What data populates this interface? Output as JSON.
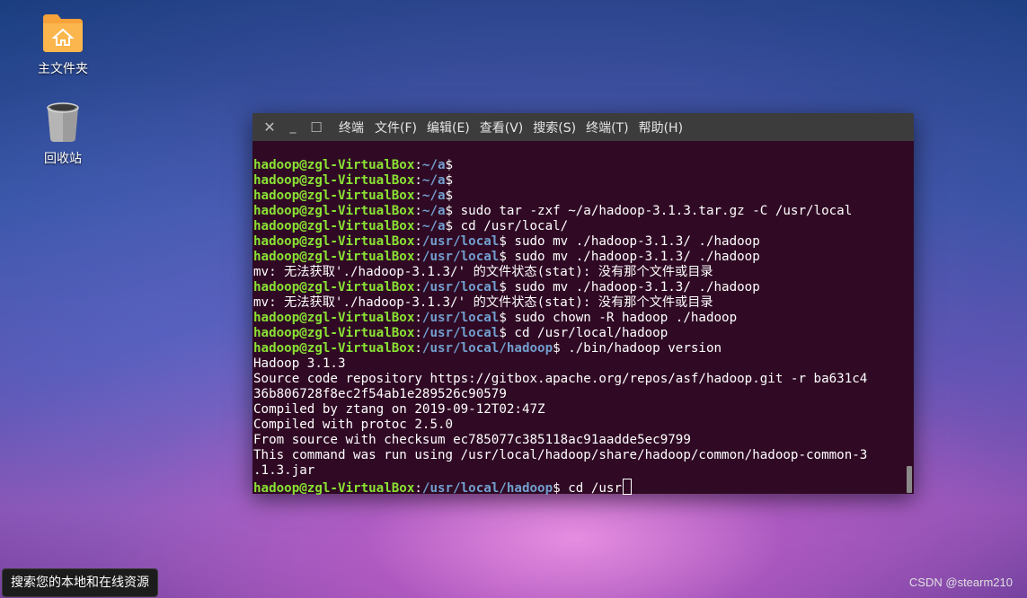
{
  "desktop": {
    "icons": [
      {
        "label": "主文件夹",
        "icon": "home-folder-icon"
      },
      {
        "label": "回收站",
        "icon": "trash-icon"
      }
    ],
    "search_tooltip": "搜索您的本地和在线资源",
    "watermark": "CSDN @stearm210"
  },
  "terminal": {
    "title": "终端",
    "window_buttons": [
      "✕",
      "_",
      "☐"
    ],
    "menu": [
      "文件(F)",
      "编辑(E)",
      "查看(V)",
      "搜索(S)",
      "终端(T)",
      "帮助(H)"
    ],
    "lines": [
      {
        "user": "hadoop@zgl-VirtualBox",
        "path": "~/a",
        "text": "$"
      },
      {
        "user": "hadoop@zgl-VirtualBox",
        "path": "~/a",
        "text": "$"
      },
      {
        "user": "hadoop@zgl-VirtualBox",
        "path": "~/a",
        "text": "$"
      },
      {
        "user": "hadoop@zgl-VirtualBox",
        "path": "~/a",
        "text": "$ sudo tar -zxf ~/a/hadoop-3.1.3.tar.gz -C /usr/local"
      },
      {
        "user": "hadoop@zgl-VirtualBox",
        "path": "~/a",
        "text": "$ cd /usr/local/"
      },
      {
        "user": "hadoop@zgl-VirtualBox",
        "path": "/usr/local",
        "text": "$ sudo mv ./hadoop-3.1.3/ ./hadoop"
      },
      {
        "user": "hadoop@zgl-VirtualBox",
        "path": "/usr/local",
        "text": "$ sudo mv ./hadoop-3.1.3/ ./hadoop"
      },
      {
        "text": "mv: 无法获取'./hadoop-3.1.3/' 的文件状态(stat): 没有那个文件或目录"
      },
      {
        "user": "hadoop@zgl-VirtualBox",
        "path": "/usr/local",
        "text": "$ sudo mv ./hadoop-3.1.3/ ./hadoop"
      },
      {
        "text": "mv: 无法获取'./hadoop-3.1.3/' 的文件状态(stat): 没有那个文件或目录"
      },
      {
        "user": "hadoop@zgl-VirtualBox",
        "path": "/usr/local",
        "text": "$ sudo chown -R hadoop ./hadoop"
      },
      {
        "user": "hadoop@zgl-VirtualBox",
        "path": "/usr/local",
        "text": "$ cd /usr/local/hadoop"
      },
      {
        "user": "hadoop@zgl-VirtualBox",
        "path": "/usr/local/hadoop",
        "text": "$ ./bin/hadoop version"
      },
      {
        "text": "Hadoop 3.1.3"
      },
      {
        "text": "Source code repository https://gitbox.apache.org/repos/asf/hadoop.git -r ba631c4"
      },
      {
        "text": "36b806728f8ec2f54ab1e289526c90579"
      },
      {
        "text": "Compiled by ztang on 2019-09-12T02:47Z"
      },
      {
        "text": "Compiled with protoc 2.5.0"
      },
      {
        "text": "From source with checksum ec785077c385118ac91aadde5ec9799"
      },
      {
        "text": "This command was run using /usr/local/hadoop/share/hadoop/common/hadoop-common-3"
      },
      {
        "text": ".1.3.jar"
      },
      {
        "user": "hadoop@zgl-VirtualBox",
        "path": "/usr/local/hadoop",
        "text": "$ cd /usr",
        "cursor": true
      }
    ]
  },
  "colors": {
    "terminal_bg": "#300a24",
    "prompt_user": "#8ae234",
    "prompt_path": "#729fcf",
    "titlebar": "#3c3c3c"
  }
}
